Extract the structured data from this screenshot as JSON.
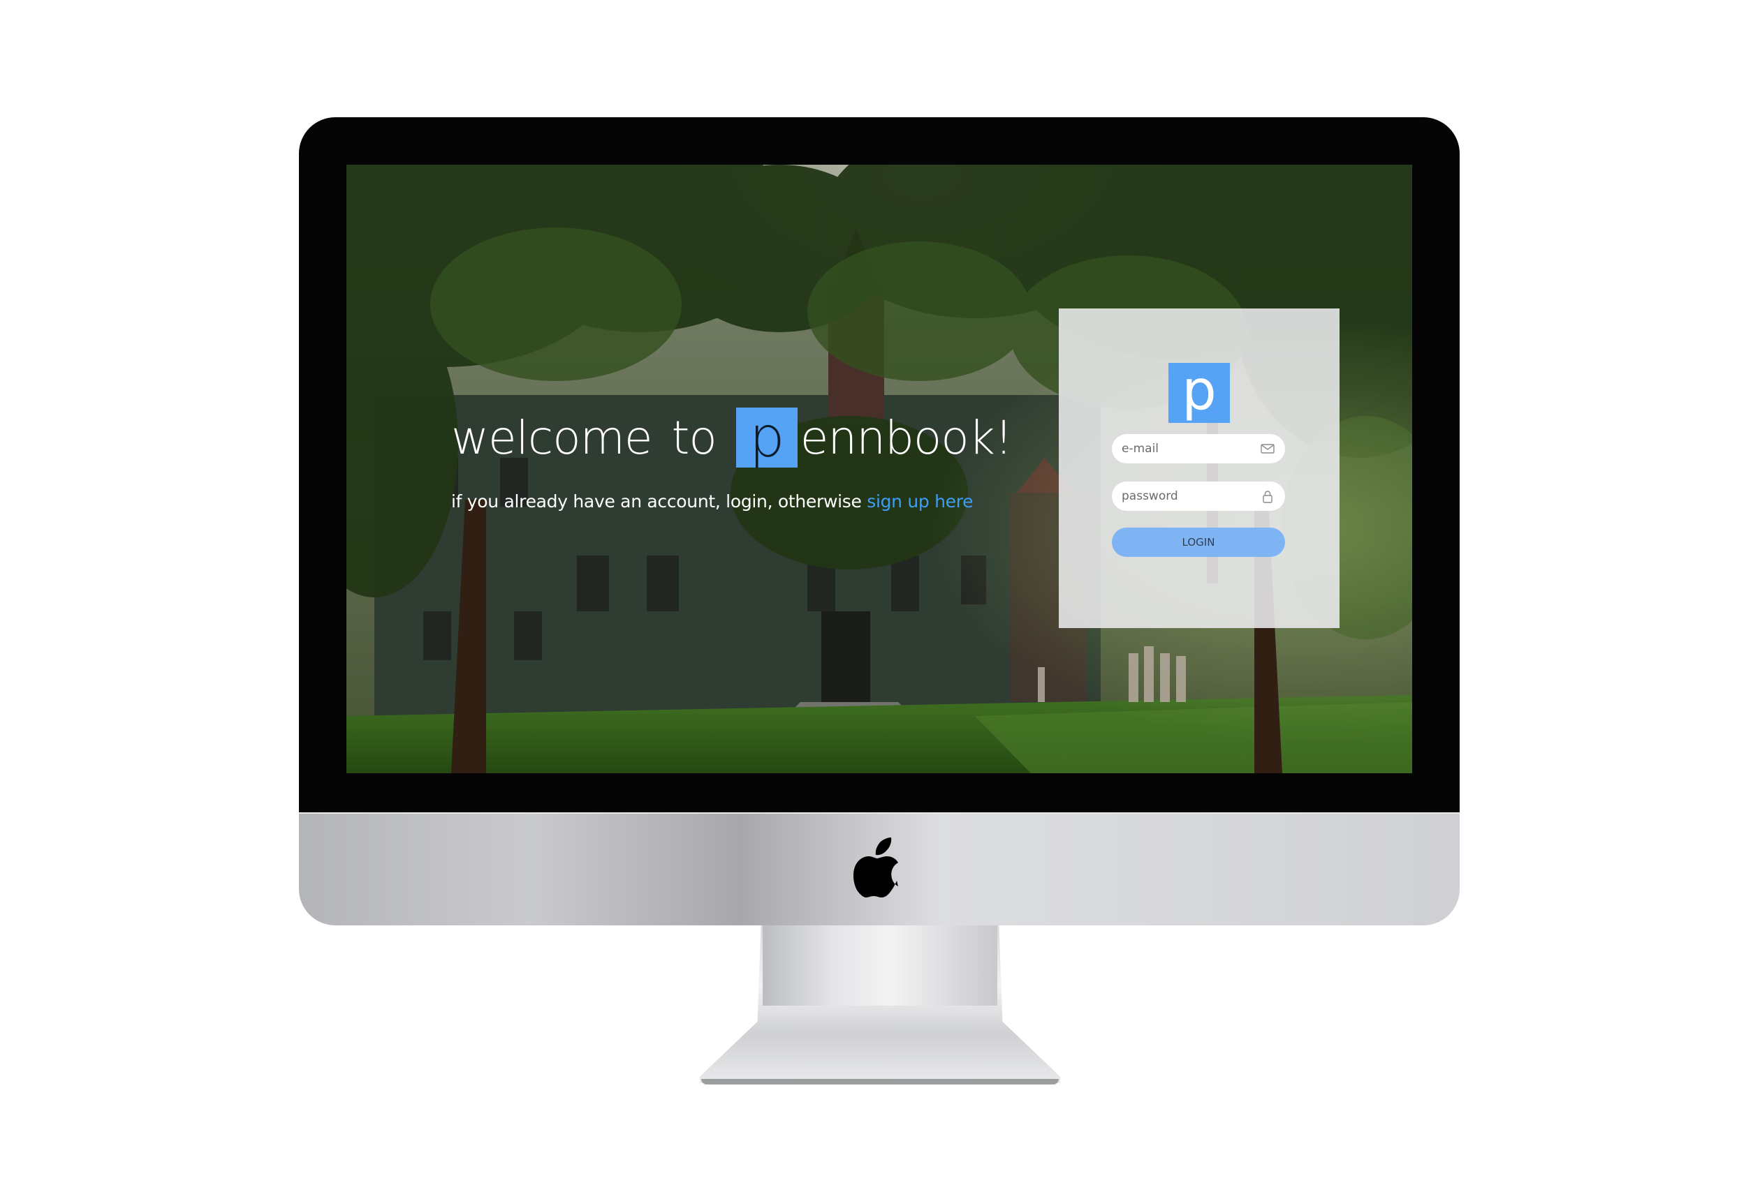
{
  "welcome": {
    "part1": "welcome",
    "part2": "to",
    "logo_letter": "p",
    "part3": "ennbook!"
  },
  "subtitle": {
    "text": "if you already have an account, login, otherwise ",
    "link_text": "sign up here"
  },
  "login_card": {
    "logo_letter": "p",
    "email_placeholder": "e-mail",
    "password_placeholder": "password",
    "login_label": "LOGIN"
  },
  "icons": {
    "email": "envelope-icon",
    "password": "lock-icon",
    "brand": "apple-logo-icon"
  },
  "colors": {
    "brand_blue": "#56a3f5",
    "link_blue": "#3e9df5",
    "button_blue": "#7eb4f3",
    "card_bg": "#ececee"
  }
}
